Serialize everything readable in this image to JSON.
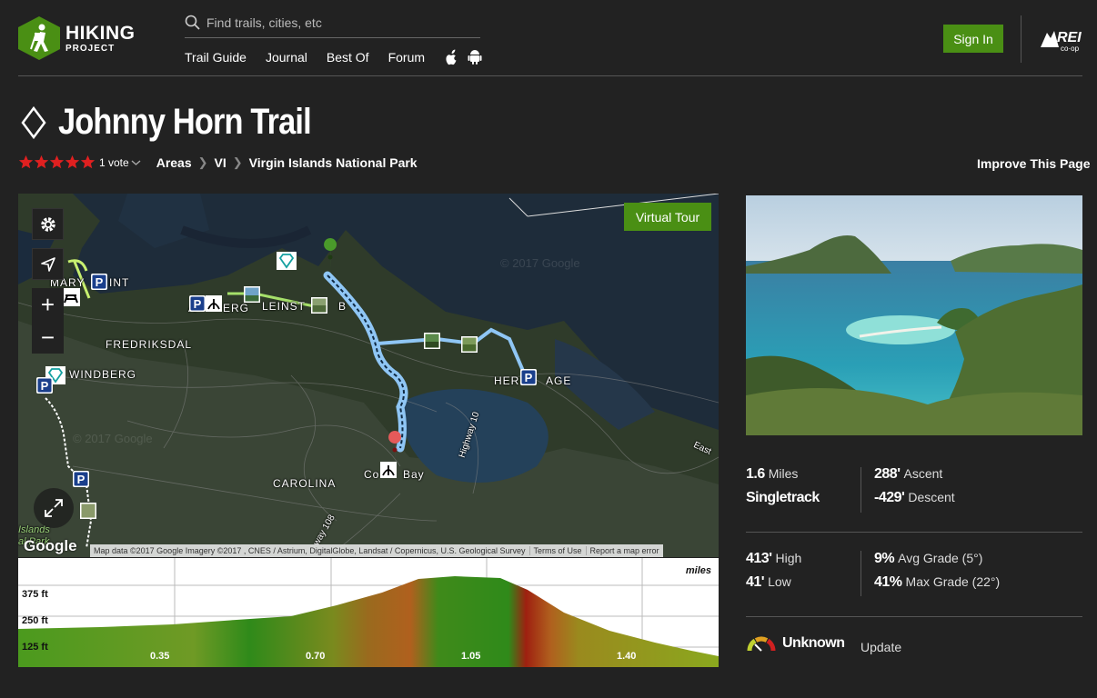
{
  "header": {
    "logo_line1": "HIKING",
    "logo_line2": "PROJECT",
    "search_placeholder": "Find trails, cities, etc",
    "nav": [
      "Trail Guide",
      "Journal",
      "Best Of",
      "Forum"
    ],
    "signin": "Sign In",
    "partner_logo_text": "REI co-op"
  },
  "trail": {
    "title": "Johnny Horn Trail",
    "difficulty_icon": "diamond-icon",
    "rating_stars": 5,
    "votes": "1 vote",
    "breadcrumbs": [
      "Areas",
      "VI",
      "Virgin Islands National Park"
    ],
    "improve": "Improve This Page"
  },
  "map": {
    "virtual_tour": "Virtual Tour",
    "labels": [
      "MARY",
      "INT",
      "A",
      "ERG",
      "LEINST",
      "B",
      "FREDRIKSDAL",
      "WINDBERG",
      "HER",
      "AGE",
      "CAROLINA",
      "Co",
      "Bay",
      "Islands",
      "al Park",
      "Highway 10",
      "way 108",
      "East"
    ],
    "watermark": "© 2017 Google",
    "google": "Google",
    "attribution": [
      "Map data ©2017 Google Imagery ©2017 , CNES / Astrium, DigitalGlobe, Landsat / Copernicus, U.S. Geological Survey",
      "Terms of Use",
      "Report a map error"
    ]
  },
  "elevation": {
    "unit": "miles",
    "y_ticks": [
      "375 ft",
      "250 ft",
      "125 ft"
    ],
    "x_ticks": [
      "0.35",
      "0.70",
      "1.05",
      "1.40"
    ]
  },
  "stats": {
    "distance_value": "1.6",
    "distance_unit": "Miles",
    "type": "Singletrack",
    "ascent_value": "288'",
    "ascent_label": "Ascent",
    "descent_value": "-429'",
    "descent_label": "Descent",
    "high_value": "413'",
    "high_label": "High",
    "low_value": "41'",
    "low_label": "Low",
    "avg_grade_value": "9%",
    "avg_grade_label": "Avg Grade (5°)",
    "max_grade_value": "41%",
    "max_grade_label": "Max Grade (22°)"
  },
  "conditions": {
    "status": "Unknown",
    "update": "Update"
  },
  "colors": {
    "accent_green": "#4a8f14",
    "trail_blue": "#8fc6f5",
    "star_red": "#e02020"
  }
}
